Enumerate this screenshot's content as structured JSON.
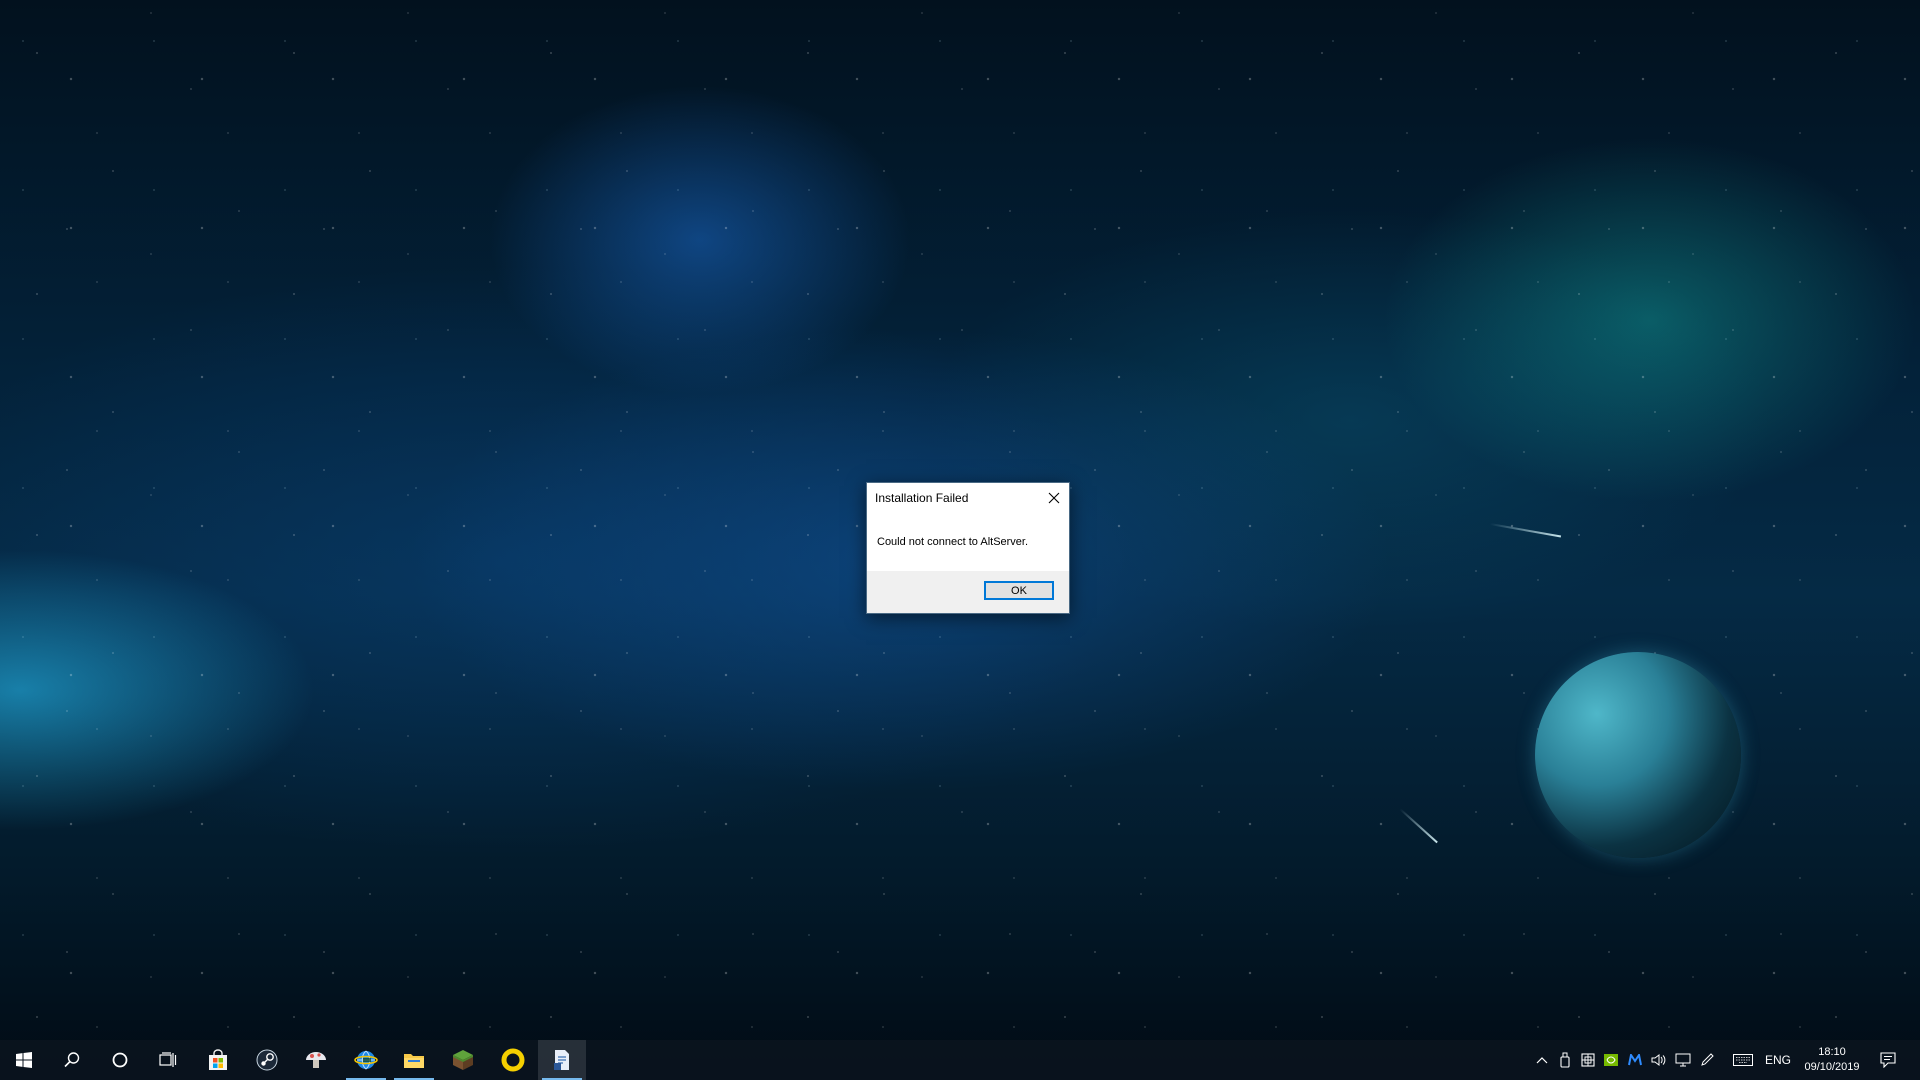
{
  "dialog": {
    "title": "Installation Failed",
    "message": "Could not connect to AltServer.",
    "ok_label": "OK",
    "close_icon": "close-icon"
  },
  "taskbar": {
    "pinned": [
      {
        "name": "start",
        "icon": "windows-logo-icon"
      },
      {
        "name": "search",
        "icon": "search-icon"
      },
      {
        "name": "cortana",
        "icon": "cortana-circle-icon"
      },
      {
        "name": "task-view",
        "icon": "task-view-icon"
      },
      {
        "name": "microsoft-store",
        "icon": "store-bag-icon"
      },
      {
        "name": "steam",
        "icon": "steam-icon"
      },
      {
        "name": "app-mushroom",
        "icon": "mushroom-icon"
      },
      {
        "name": "app-globe",
        "icon": "globe-icon"
      },
      {
        "name": "file-explorer",
        "icon": "folder-icon"
      },
      {
        "name": "minecraft",
        "icon": "grass-block-icon"
      },
      {
        "name": "app-ring",
        "icon": "yellow-ring-icon"
      },
      {
        "name": "document-app",
        "icon": "document-icon"
      }
    ],
    "tray": {
      "language": "ENG",
      "time": "18:10",
      "date": "09/10/2019"
    }
  },
  "colors": {
    "accent": "#0078d7",
    "taskbar_bg": "#0a141e",
    "dialog_footer": "#f0f0f0"
  }
}
